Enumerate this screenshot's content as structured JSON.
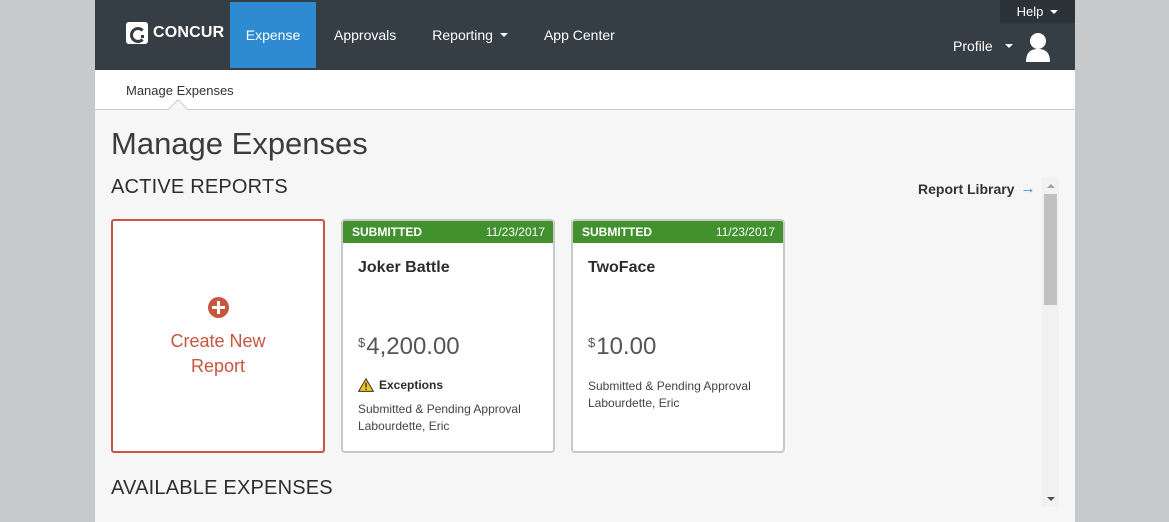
{
  "brand": {
    "logo_text": "CONCUR"
  },
  "nav": {
    "items": [
      {
        "label": "Expense",
        "active": true
      },
      {
        "label": "Approvals"
      },
      {
        "label": "Reporting",
        "dropdown": true
      },
      {
        "label": "App Center"
      }
    ],
    "help_label": "Help",
    "profile_label": "Profile"
  },
  "breadcrumb": {
    "label": "Manage Expenses"
  },
  "page": {
    "title": "Manage Expenses",
    "active_reports_title": "ACTIVE REPORTS",
    "report_library_label": "Report Library",
    "available_expenses_title": "AVAILABLE EXPENSES"
  },
  "create_card": {
    "label": "Create New Report"
  },
  "reports": [
    {
      "status": "SUBMITTED",
      "date": "11/23/2017",
      "name": "Joker Battle",
      "currency": "$",
      "amount": "4,200.00",
      "exceptions_label": "Exceptions",
      "approval_status": "Submitted & Pending Approval",
      "approver": "Labourdette, Eric"
    },
    {
      "status": "SUBMITTED",
      "date": "11/23/2017",
      "name": "TwoFace",
      "currency": "$",
      "amount": "10.00",
      "approval_status": "Submitted & Pending Approval",
      "approver": "Labourdette, Eric"
    }
  ],
  "colors": {
    "topbar": "#353d45",
    "nav_active": "#2e8ad1",
    "status_green": "#41922e",
    "create_accent": "#c8553d"
  }
}
